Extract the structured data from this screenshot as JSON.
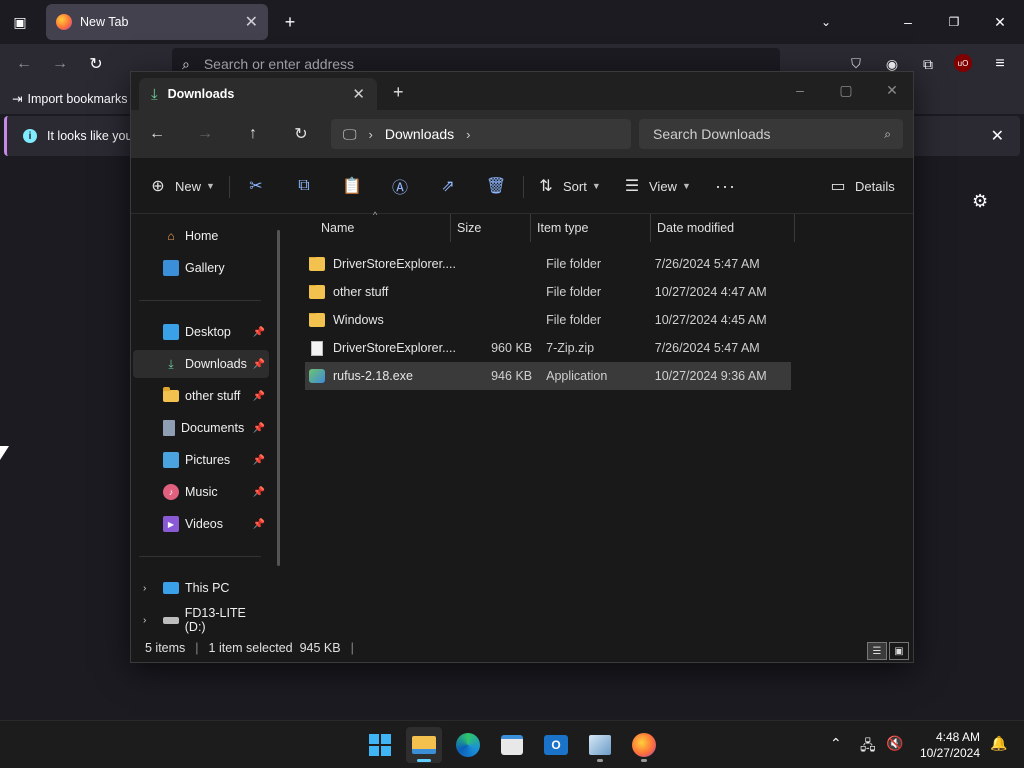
{
  "browser": {
    "tab_title": "New Tab",
    "url_placeholder": "Search or enter address",
    "bookmarks_import_label": "Import bookmarks",
    "notification_text": "It looks like you"
  },
  "explorer": {
    "tab_title": "Downloads",
    "breadcrumb": "Downloads",
    "search_placeholder": "Search Downloads",
    "commands": {
      "new": "New",
      "sort": "Sort",
      "view": "View",
      "details": "Details"
    },
    "nav": {
      "home": "Home",
      "gallery": "Gallery",
      "desktop": "Desktop",
      "downloads": "Downloads",
      "other_stuff": "other stuff",
      "documents": "Documents",
      "pictures": "Pictures",
      "music": "Music",
      "videos": "Videos",
      "this_pc": "This PC",
      "drive_d": "FD13-LITE (D:)"
    },
    "columns": {
      "name": "Name",
      "size": "Size",
      "type": "Item type",
      "date": "Date modified"
    },
    "files": [
      {
        "name": "DriverStoreExplorer....",
        "size": "",
        "type": "File folder",
        "date": "7/26/2024 5:47 AM",
        "kind": "folder"
      },
      {
        "name": "other stuff",
        "size": "",
        "type": "File folder",
        "date": "10/27/2024 4:47 AM",
        "kind": "folder"
      },
      {
        "name": "Windows",
        "size": "",
        "type": "File folder",
        "date": "10/27/2024 4:45 AM",
        "kind": "folder"
      },
      {
        "name": "DriverStoreExplorer....",
        "size": "960 KB",
        "type": "7-Zip.zip",
        "date": "7/26/2024 5:47 AM",
        "kind": "file"
      },
      {
        "name": "rufus-2.18.exe",
        "size": "946 KB",
        "type": "Application",
        "date": "10/27/2024 9:36 AM",
        "kind": "exe",
        "selected": true
      }
    ],
    "status": {
      "item_count": "5 items",
      "selection": "1 item selected  945 KB"
    }
  },
  "taskbar": {
    "time": "4:48 AM",
    "date": "10/27/2024"
  },
  "colors": {
    "accent": "#60cdff",
    "folder": "#f2c14e"
  }
}
